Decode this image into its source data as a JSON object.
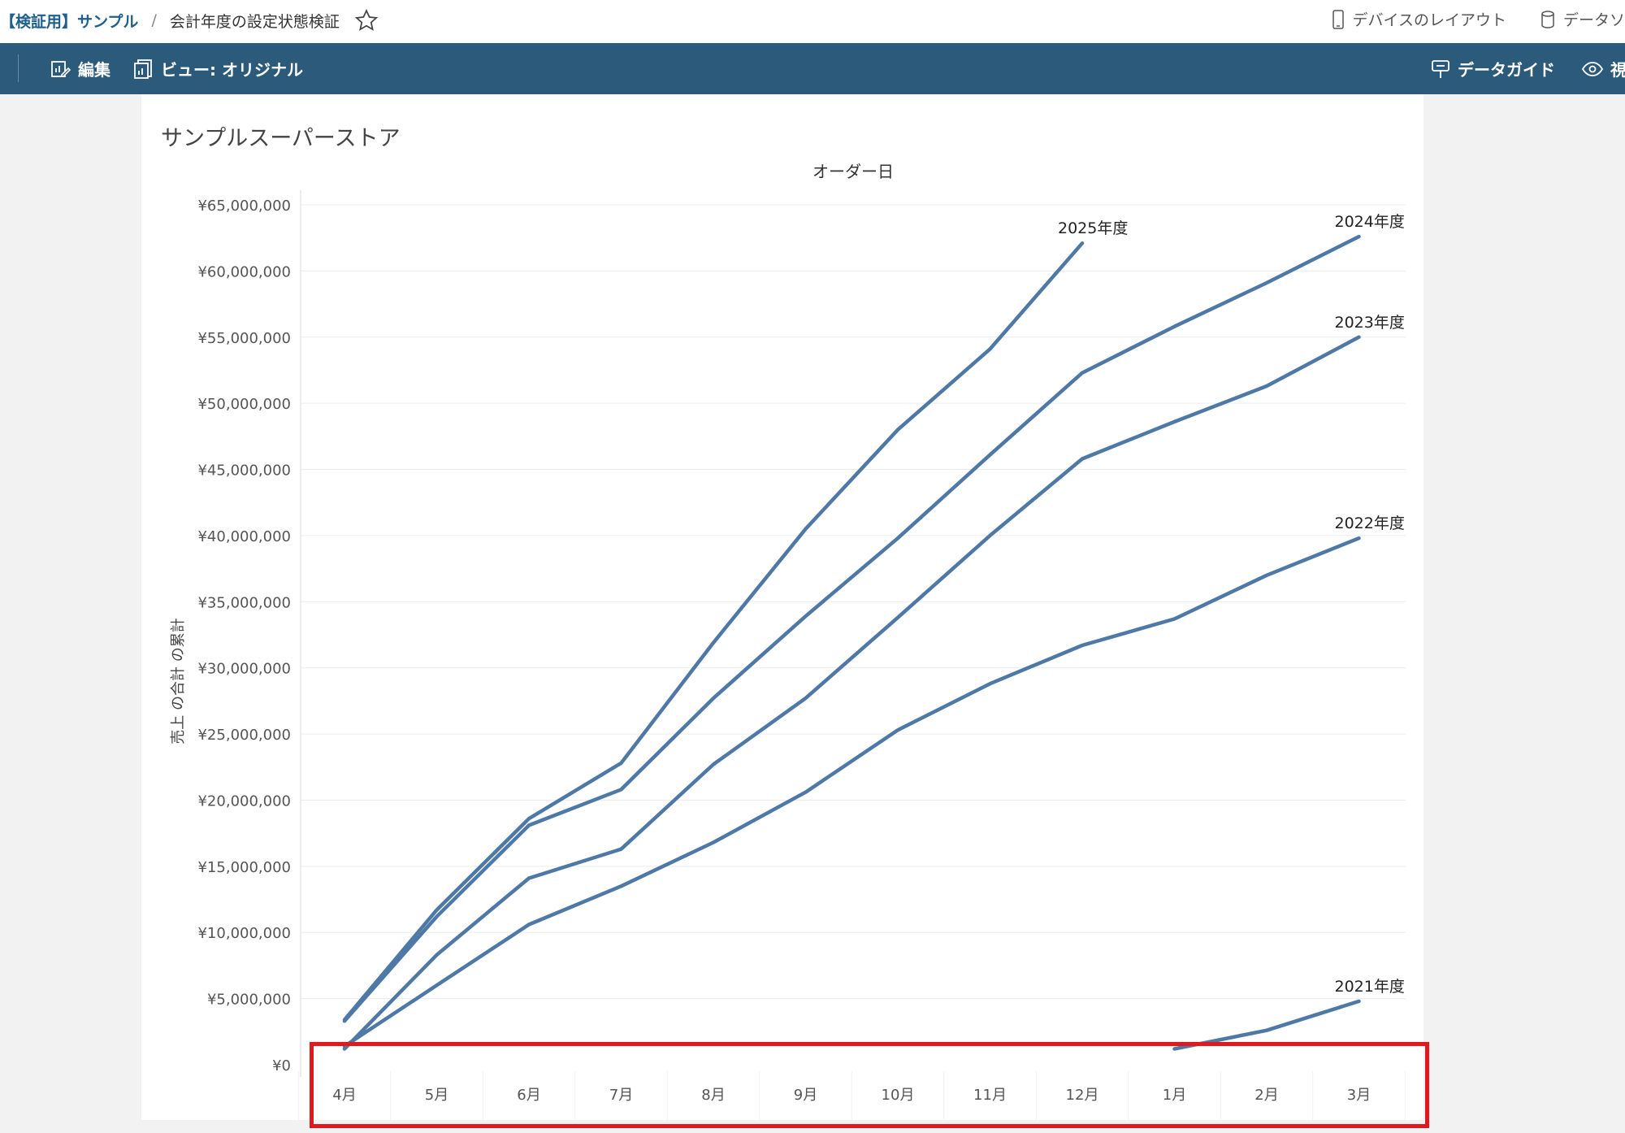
{
  "breadcrumb": {
    "project": "【検証用】サンプル",
    "separator": "/",
    "workbook": "会計年度の設定状態検証"
  },
  "topbar": {
    "device_layout": "デバイスのレイアウト",
    "data_source": "データソ"
  },
  "toolbar": {
    "edit": "編集",
    "view": "ビュー: オリジナル",
    "data_guide": "データガイド",
    "watch": "視"
  },
  "sheet_title": "サンプルスーパーストア",
  "colors": {
    "line": "#4e79a7",
    "toolbar": "#2c5a7b",
    "highlight": "#e0191f"
  },
  "chart_data": {
    "type": "line",
    "column_header": "オーダー日",
    "ylabel": "売上 の合計 の累計",
    "xlabel": "",
    "categories": [
      "4月",
      "5月",
      "6月",
      "7月",
      "8月",
      "9月",
      "10月",
      "11月",
      "12月",
      "1月",
      "2月",
      "3月"
    ],
    "ylim": [
      0,
      65000000
    ],
    "y_ticks": [
      0,
      5000000,
      10000000,
      15000000,
      20000000,
      25000000,
      30000000,
      35000000,
      40000000,
      45000000,
      50000000,
      55000000,
      60000000,
      65000000
    ],
    "y_tick_labels": [
      "¥0",
      "¥5,000,000",
      "¥10,000,000",
      "¥15,000,000",
      "¥20,000,000",
      "¥25,000,000",
      "¥30,000,000",
      "¥35,000,000",
      "¥40,000,000",
      "¥45,000,000",
      "¥50,000,000",
      "¥55,000,000",
      "¥60,000,000",
      "¥65,000,000"
    ],
    "grid": true,
    "series": [
      {
        "name": "2021年度",
        "values": [
          null,
          null,
          null,
          null,
          null,
          null,
          null,
          null,
          null,
          1200000,
          2600000,
          4800000
        ]
      },
      {
        "name": "2022年度",
        "values": [
          1400000,
          6000000,
          10600000,
          13500000,
          16800000,
          20600000,
          25300000,
          28800000,
          31700000,
          33700000,
          37000000,
          39800000
        ]
      },
      {
        "name": "2023年度",
        "values": [
          1200000,
          8300000,
          14100000,
          16300000,
          22700000,
          27700000,
          33800000,
          40000000,
          45800000,
          48600000,
          51300000,
          55000000
        ]
      },
      {
        "name": "2024年度",
        "values": [
          3300000,
          11200000,
          18100000,
          20800000,
          27700000,
          33900000,
          39800000,
          46100000,
          52300000,
          55800000,
          59100000,
          62600000
        ]
      },
      {
        "name": "2025年度",
        "values": [
          3400000,
          11700000,
          18600000,
          22800000,
          31900000,
          40500000,
          48000000,
          54100000,
          62100000,
          null,
          null,
          null
        ]
      }
    ]
  }
}
